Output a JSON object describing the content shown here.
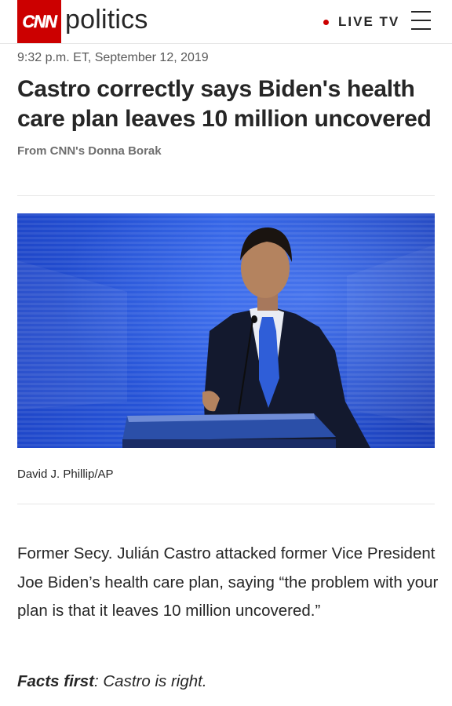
{
  "header": {
    "logo_text": "CNN",
    "section": "politics",
    "live_label": "LIVE TV"
  },
  "article": {
    "timestamp": "9:32 p.m. ET, September 12, 2019",
    "headline": "Castro correctly says Biden's health care plan leaves 10 million uncovered",
    "byline": "From CNN's Donna Borak",
    "photo_credit": "David J. Phillip/AP",
    "body": "Former Secy. Julián Castro attacked former Vice President Joe Biden’s health care plan, saying “the problem with your plan is that it leaves 10 million uncovered.”",
    "facts_label": "Facts first",
    "facts_text": ": Castro is right."
  },
  "colors": {
    "brand_red": "#cc0000",
    "text": "#262626",
    "photo_background": "#1d3fbf"
  },
  "icons": {
    "menu": "hamburger-menu-icon",
    "live": "live-dot-icon"
  }
}
